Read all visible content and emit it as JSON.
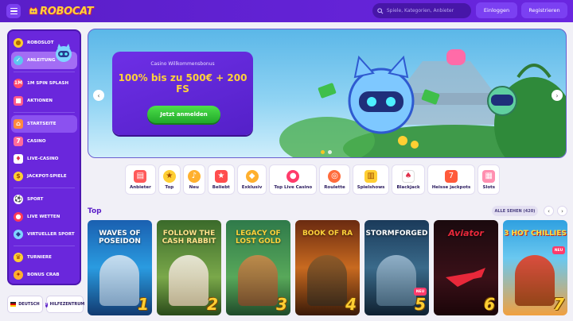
{
  "header": {
    "logo_text": "ROBOCAT",
    "search_placeholder": "Spiele, Kategorien, Anbieter",
    "login_label": "Einloggen",
    "register_label": "Registrieren"
  },
  "sidebar": {
    "items": [
      {
        "label": "ROBOSLOT",
        "icon": "coin-stack-icon"
      },
      {
        "label": "ANLEITUNG",
        "icon": "guide-icon"
      },
      {
        "label": "1M SPIN SPLASH",
        "icon": "spin-icon"
      },
      {
        "label": "AKTIONEN",
        "icon": "gift-icon"
      },
      {
        "label": "STARTSEITE",
        "icon": "home-icon"
      },
      {
        "label": "CASINO",
        "icon": "slot-icon"
      },
      {
        "label": "LIVE-CASINO",
        "icon": "cards-icon"
      },
      {
        "label": "JACKPOT-SPIELE",
        "icon": "jackpot-icon"
      },
      {
        "label": "SPORT",
        "icon": "ball-icon"
      },
      {
        "label": "LIVE WETTEN",
        "icon": "live-icon"
      },
      {
        "label": "VIRTUELLER SPORT",
        "icon": "virtual-sport-icon"
      },
      {
        "label": "TURNIERE",
        "icon": "trophy-icon"
      },
      {
        "label": "BONUS CRAB",
        "icon": "crab-icon"
      }
    ],
    "footer": {
      "language_label": "DEUTSCH",
      "help_label": "HILFEZENTRUM"
    }
  },
  "hero": {
    "subtitle": "Casino Willkommensbonus",
    "title": "100% bis zu 500€ + 200 FS",
    "cta_label": "Jetzt anmelden"
  },
  "categories": [
    {
      "label": "Anbieter",
      "icon": "provider-icon"
    },
    {
      "label": "Top",
      "icon": "medal-icon"
    },
    {
      "label": "Neu",
      "icon": "bell-icon"
    },
    {
      "label": "Beliebt",
      "icon": "star-icon"
    },
    {
      "label": "Exklusiv",
      "icon": "diamond-icon"
    },
    {
      "label": "Top Live Casino",
      "icon": "roulette-chip-icon"
    },
    {
      "label": "Roulette",
      "icon": "roulette-icon"
    },
    {
      "label": "Spielshows",
      "icon": "showwheel-icon"
    },
    {
      "label": "Blackjack",
      "icon": "cards-icon"
    },
    {
      "label": "Heisse jackpots",
      "icon": "hot-jackpot-icon"
    },
    {
      "label": "Slots",
      "icon": "slot-machine-icon"
    }
  ],
  "top_section": {
    "title": "Top",
    "see_all_label": "ALLE SEHEN (420)"
  },
  "games": [
    {
      "name": "WAVES OF POSEIDON",
      "rank": "1",
      "badge": ""
    },
    {
      "name": "FOLLOW THE CASH RABBIT",
      "rank": "2",
      "badge": ""
    },
    {
      "name": "LEGACY OF LOST GOLD",
      "rank": "3",
      "badge": ""
    },
    {
      "name": "BOOK OF RA",
      "rank": "4",
      "badge": ""
    },
    {
      "name": "STORMFORGED",
      "rank": "5",
      "badge": "NEU"
    },
    {
      "name": "Aviator",
      "rank": "6",
      "badge": ""
    },
    {
      "name": "3 HOT CHILLIES",
      "rank": "7",
      "badge": "NEU"
    }
  ],
  "colors": {
    "brand_purple": "#5a1ec8",
    "accent_yellow": "#ffd23a",
    "cta_green": "#20a82a"
  }
}
